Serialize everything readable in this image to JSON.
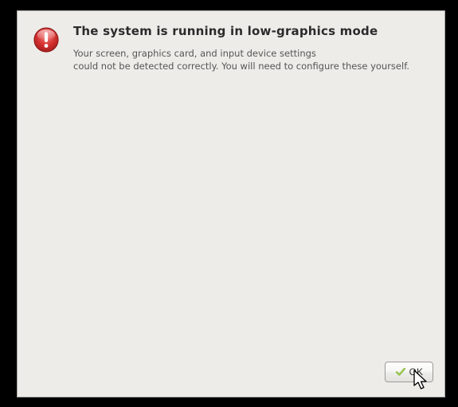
{
  "dialog": {
    "title": "The system is running in low-graphics mode",
    "body": "Your screen, graphics card, and input device settings\ncould not be detected correctly.  You will need to configure these yourself."
  },
  "buttons": {
    "ok_label": "OK"
  },
  "icons": {
    "warning": "warning-icon",
    "ok_check": "check-icon"
  }
}
